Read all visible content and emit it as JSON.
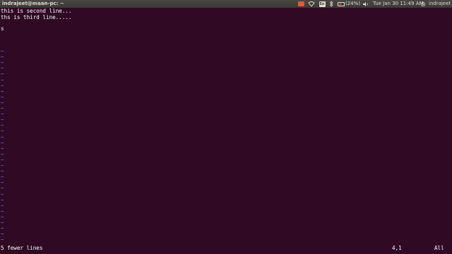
{
  "topbar": {
    "window_title": "indrajeet@maan-pc: ~",
    "keyboard_layout": "En",
    "battery": "(24%)",
    "clock": "Tue Jan 30 11:49 AM",
    "user": "indrajeet",
    "icons": [
      "mail-icon",
      "wifi-icon",
      "keyboard-icon",
      "bluetooth-icon",
      "battery-icon",
      "volume-icon",
      "gear-icon"
    ],
    "colors": {
      "panel": "#3c3b37",
      "mail_indicator": "#e05a3a",
      "battery_low": "#e0443a"
    }
  },
  "terminal": {
    "background": "#300a24",
    "tilde_color": "#6c6cf0",
    "lines": [
      "this is second line...",
      "ths is third line.....",
      "",
      "s"
    ],
    "empty_line_marker": "~",
    "status_message": "5 fewer lines",
    "cursor_position": "4,1",
    "scroll_position": "All"
  }
}
